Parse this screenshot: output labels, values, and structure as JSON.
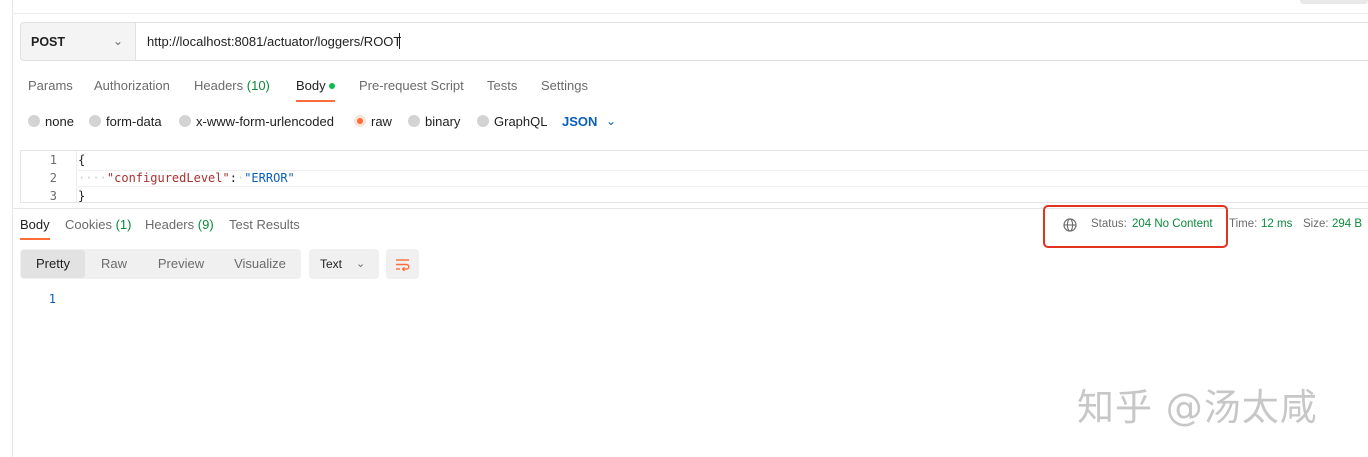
{
  "request": {
    "method": "POST",
    "url": "http://localhost:8081/actuator/loggers/ROOT"
  },
  "request_tabs": [
    {
      "label": "Params"
    },
    {
      "label": "Authorization"
    },
    {
      "label": "Headers",
      "count": "(10)"
    },
    {
      "label": "Body"
    },
    {
      "label": "Pre-request Script"
    },
    {
      "label": "Tests"
    },
    {
      "label": "Settings"
    }
  ],
  "body_types": [
    "none",
    "form-data",
    "x-www-form-urlencoded",
    "raw",
    "binary",
    "GraphQL"
  ],
  "body_type_selected": "raw",
  "body_language": "JSON",
  "editor": {
    "line_numbers": [
      "1",
      "2",
      "3"
    ],
    "line1": "{",
    "line2_indent": "····",
    "line2_key": "\"configuredLevel\"",
    "line2_colon": ":",
    "line2_value": "\"ERROR\"",
    "line3": "}"
  },
  "response_tabs": [
    {
      "label": "Body"
    },
    {
      "label": "Cookies",
      "count": "(1)"
    },
    {
      "label": "Headers",
      "count": "(9)"
    },
    {
      "label": "Test Results"
    }
  ],
  "response_meta": {
    "status_label": "Status:",
    "status_value": "204 No Content",
    "time_label": "Time:",
    "time_value": "12 ms",
    "size_label": "Size:",
    "size_value": "294 B"
  },
  "view_modes": [
    "Pretty",
    "Raw",
    "Preview",
    "Visualize"
  ],
  "view_mode_active": "Pretty",
  "format": "Text",
  "response_line_numbers": [
    "1"
  ],
  "watermark": "知乎 @汤太咸",
  "colors": {
    "accent": "#ff6c37",
    "success": "#0a8a3a",
    "link": "#0b5fb8",
    "highlight_box": "#e2331e"
  }
}
